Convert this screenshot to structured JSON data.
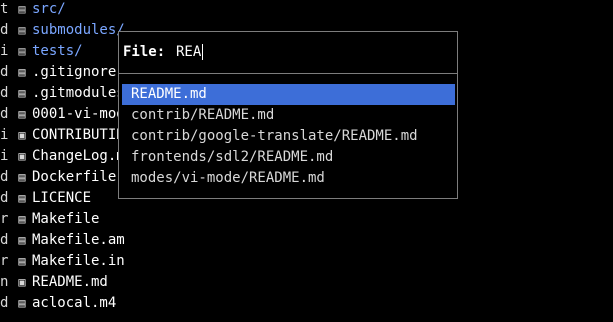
{
  "file_list": [
    {
      "perm": "t",
      "icon": "folder-icon",
      "name": "src/",
      "kind": "dir"
    },
    {
      "perm": "d",
      "icon": "folder-icon",
      "name": "submodules/",
      "kind": "dir"
    },
    {
      "perm": "i",
      "icon": "folder-icon",
      "name": "tests/",
      "kind": "dir"
    },
    {
      "perm": "d",
      "icon": "document-icon",
      "name": ".gitignore",
      "kind": "file"
    },
    {
      "perm": "d",
      "icon": "document-icon",
      "name": ".gitmodules",
      "kind": "file"
    },
    {
      "perm": "d",
      "icon": "document-icon",
      "name": "0001-vi-mode",
      "kind": "file"
    },
    {
      "perm": "i",
      "icon": "markdown-icon",
      "name": "CONTRIBUTING",
      "kind": "file"
    },
    {
      "perm": "i",
      "icon": "markdown-icon",
      "name": "ChangeLog.md",
      "kind": "file"
    },
    {
      "perm": "d",
      "icon": "document-icon",
      "name": "Dockerfile",
      "kind": "file"
    },
    {
      "perm": "d",
      "icon": "document-icon",
      "name": "LICENCE",
      "kind": "file"
    },
    {
      "perm": "r",
      "icon": "document-icon",
      "name": "Makefile",
      "kind": "file"
    },
    {
      "perm": "d",
      "icon": "document-icon",
      "name": "Makefile.am",
      "kind": "file"
    },
    {
      "perm": "r",
      "icon": "document-icon",
      "name": "Makefile.in",
      "kind": "file"
    },
    {
      "perm": "n",
      "icon": "markdown-icon",
      "name": "README.md",
      "kind": "file"
    },
    {
      "perm": "d",
      "icon": "document-icon",
      "name": "aclocal.m4",
      "kind": "file"
    }
  ],
  "popup": {
    "label": "File:",
    "query": "REA",
    "results": [
      {
        "text": "README.md",
        "selected": true
      },
      {
        "text": "contrib/README.md",
        "selected": false
      },
      {
        "text": "contrib/google-translate/README.md",
        "selected": false
      },
      {
        "text": "frontends/sdl2/README.md",
        "selected": false
      },
      {
        "text": "modes/vi-mode/README.md",
        "selected": false
      }
    ]
  },
  "colors": {
    "background": "#000000",
    "directory": "#7aa6ff",
    "selection": "#3d6ed8",
    "border": "#7d7d7d"
  }
}
